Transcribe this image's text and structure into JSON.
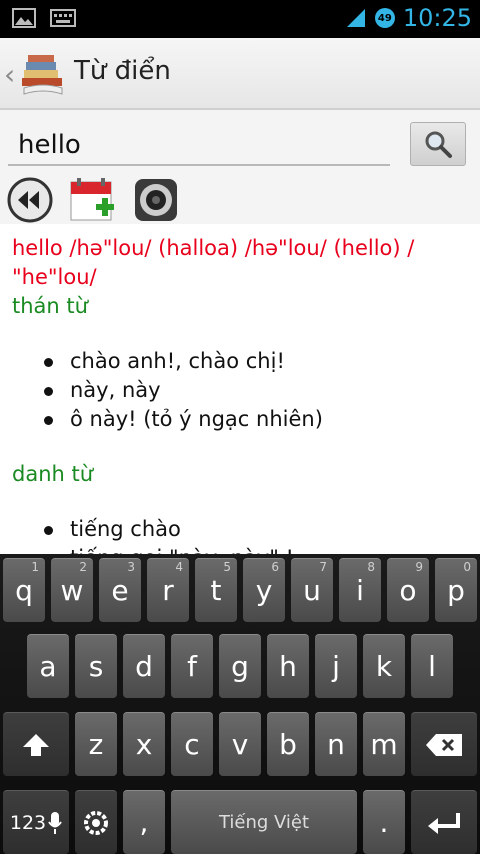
{
  "status_bar": {
    "time": "10:25",
    "battery_level": "49",
    "icons": [
      "image-icon",
      "keyboard-icon",
      "signal-icon"
    ]
  },
  "action_bar": {
    "title": "Từ điển"
  },
  "search": {
    "value": "hello"
  },
  "entry": {
    "headword_line": "hello /hə\"lou/ (halloa) /hə\"lou/ (hello) / \"he\"lou/",
    "sections": [
      {
        "pos": "thán từ",
        "senses": [
          "chào anh!, chào chị!",
          "này, này",
          "ô này! (tỏ ý ngạc nhiên)"
        ]
      },
      {
        "pos": "danh từ",
        "senses": [
          "tiếng chào",
          "tiếng gọi \"này, này\" !"
        ]
      }
    ]
  },
  "keyboard": {
    "row1": [
      {
        "label": "q",
        "hint": "1"
      },
      {
        "label": "w",
        "hint": "2"
      },
      {
        "label": "e",
        "hint": "3"
      },
      {
        "label": "r",
        "hint": "4"
      },
      {
        "label": "t",
        "hint": "5"
      },
      {
        "label": "y",
        "hint": "6"
      },
      {
        "label": "u",
        "hint": "7"
      },
      {
        "label": "i",
        "hint": "8"
      },
      {
        "label": "o",
        "hint": "9"
      },
      {
        "label": "p",
        "hint": "0"
      }
    ],
    "row2": [
      "a",
      "s",
      "d",
      "f",
      "g",
      "h",
      "j",
      "k",
      "l"
    ],
    "row3": [
      "z",
      "x",
      "c",
      "v",
      "b",
      "n",
      "m"
    ],
    "numbers_label": "123",
    "comma_label": ",",
    "space_label": "Tiếng Việt",
    "period_label": "."
  }
}
